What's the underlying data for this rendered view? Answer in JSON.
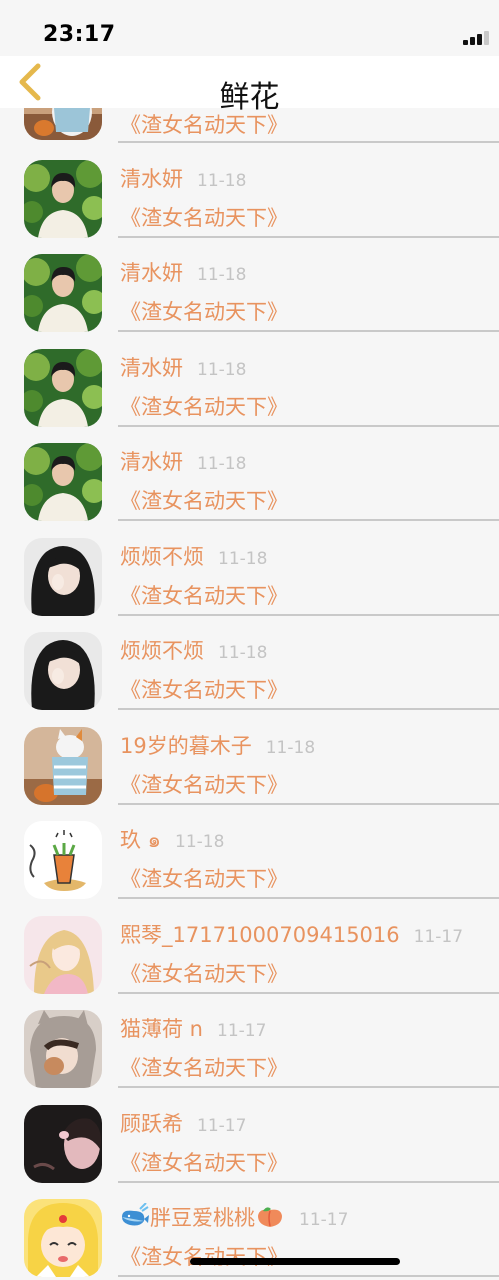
{
  "status_bar": {
    "time": "23:17"
  },
  "nav": {
    "title": "鲜花",
    "back_icon": "chevron-left-icon"
  },
  "colors": {
    "accent": "#e8935f",
    "date": "#c4c4c4",
    "divider": "#c9c9c9",
    "back": "#e5b84c"
  },
  "partial_row": {
    "work": "《渣女名动天下》",
    "avatar": "cat"
  },
  "rows": [
    {
      "name": "清水妍",
      "date": "11-18",
      "work": "《渣女名动天下》",
      "avatar": "man"
    },
    {
      "name": "清水妍",
      "date": "11-18",
      "work": "《渣女名动天下》",
      "avatar": "man"
    },
    {
      "name": "清水妍",
      "date": "11-18",
      "work": "《渣女名动天下》",
      "avatar": "man"
    },
    {
      "name": "清水妍",
      "date": "11-18",
      "work": "《渣女名动天下》",
      "avatar": "man"
    },
    {
      "name": "烦烦不烦",
      "date": "11-18",
      "work": "《渣女名动天下》",
      "avatar": "girl"
    },
    {
      "name": "烦烦不烦",
      "date": "11-18",
      "work": "《渣女名动天下》",
      "avatar": "girl"
    },
    {
      "name": "19岁的暮木子",
      "date": "11-18",
      "work": "《渣女名动天下》",
      "avatar": "cat"
    },
    {
      "name": "玖",
      "date": "11-18",
      "work": "《渣女名动天下》",
      "avatar": "carrot"
    },
    {
      "name": "熙琴_17171000709415016",
      "date": "11-17",
      "work": "《渣女名动天下》",
      "avatar": "princess"
    },
    {
      "name": "猫薄荷 n",
      "date": "11-17",
      "work": "《渣女名动天下》",
      "avatar": "hat"
    },
    {
      "name": "顾跃希",
      "date": "11-17",
      "work": "《渣女名动天下》",
      "avatar": "dark"
    },
    {
      "name": "胖豆爱桃桃",
      "date": "11-17",
      "work": "《渣女名动天下》",
      "avatar": "sailor",
      "prefix_emoji": "whale-emoji",
      "suffix_emoji": "peach-emoji"
    }
  ]
}
